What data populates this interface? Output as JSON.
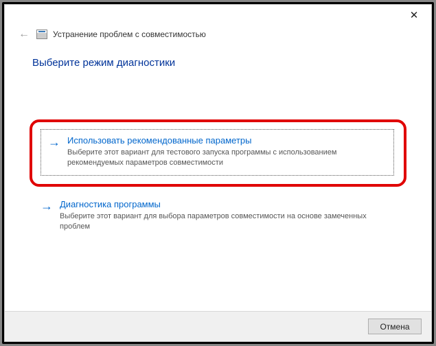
{
  "header": {
    "title": "Устранение проблем с совместимостью"
  },
  "content": {
    "heading": "Выберите режим диагностики"
  },
  "options": [
    {
      "title": "Использовать рекомендованные параметры",
      "description": "Выберите этот вариант для тестового запуска программы с использованием рекомендуемых параметров совместимости"
    },
    {
      "title": "Диагностика программы",
      "description": "Выберите этот вариант для выбора параметров совместимости на основе замеченных проблем"
    }
  ],
  "footer": {
    "cancel": "Отмена"
  }
}
